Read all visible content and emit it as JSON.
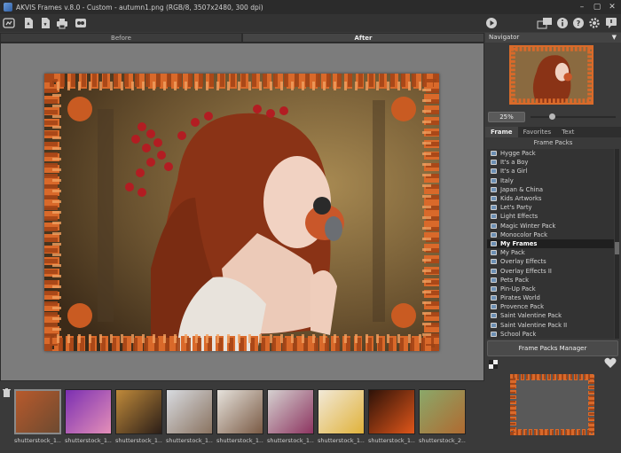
{
  "window": {
    "title": "AKVIS Frames v.8.0 - Custom - autumn1.png (RGB/8, 3507x2480, 300 dpi)"
  },
  "toolbar": {
    "left_icons": [
      "home-icon",
      "open-file-icon",
      "save-file-icon",
      "print-icon",
      "share-icon"
    ],
    "right_icons": [
      "run-icon",
      "panels-icon",
      "info-icon",
      "help-icon",
      "settings-icon",
      "notifications-icon"
    ]
  },
  "view_tabs": [
    "Before",
    "After"
  ],
  "navigator": {
    "title": "Navigator",
    "zoom": "25%"
  },
  "panel_tabs": [
    "Frame",
    "Favorites",
    "Text"
  ],
  "frame_packs": {
    "header": "Frame Packs",
    "items": [
      "Hygge Pack",
      "It's a Boy",
      "It's a Girl",
      "Italy",
      "Japan & China",
      "Kids Artworks",
      "Let's Party",
      "Light Effects",
      "Magic Winter Pack",
      "Monocolor Pack",
      "My Frames",
      "My Pack",
      "Overlay Effects",
      "Overlay Effects II",
      "Pets Pack",
      "Pin-Up Pack",
      "Pirates World",
      "Provence Pack",
      "Saint Valentine Pack",
      "Saint Valentine Pack II",
      "School Pack"
    ],
    "selected": "My Frames",
    "manager_button": "Frame Packs Manager"
  },
  "thumbnails": [
    {
      "caption": "shutterstock_1...",
      "colors": [
        "#b85a2c",
        "#6e4a30"
      ]
    },
    {
      "caption": "shutterstock_1...",
      "colors": [
        "#7b2fb2",
        "#e48fb8"
      ]
    },
    {
      "caption": "shutterstock_1...",
      "colors": [
        "#c08a3a",
        "#2b1e18"
      ]
    },
    {
      "caption": "shutterstock_1...",
      "colors": [
        "#d8dbe0",
        "#8a7360"
      ]
    },
    {
      "caption": "shutterstock_1...",
      "colors": [
        "#e6e2dc",
        "#7a5a44"
      ]
    },
    {
      "caption": "shutterstock_1...",
      "colors": [
        "#d5d1d0",
        "#8d3460"
      ]
    },
    {
      "caption": "shutterstock_1...",
      "colors": [
        "#f2e9d8",
        "#e0b23a"
      ]
    },
    {
      "caption": "shutterstock_1...",
      "colors": [
        "#2e1208",
        "#e0561a"
      ]
    },
    {
      "caption": "shutterstock_2...",
      "colors": [
        "#8aa86a",
        "#b06a30"
      ]
    }
  ],
  "colors": {
    "frame_orange": "#d96b2a",
    "canvas_bg": "#7c7c7c",
    "list_bg": "#333333"
  }
}
